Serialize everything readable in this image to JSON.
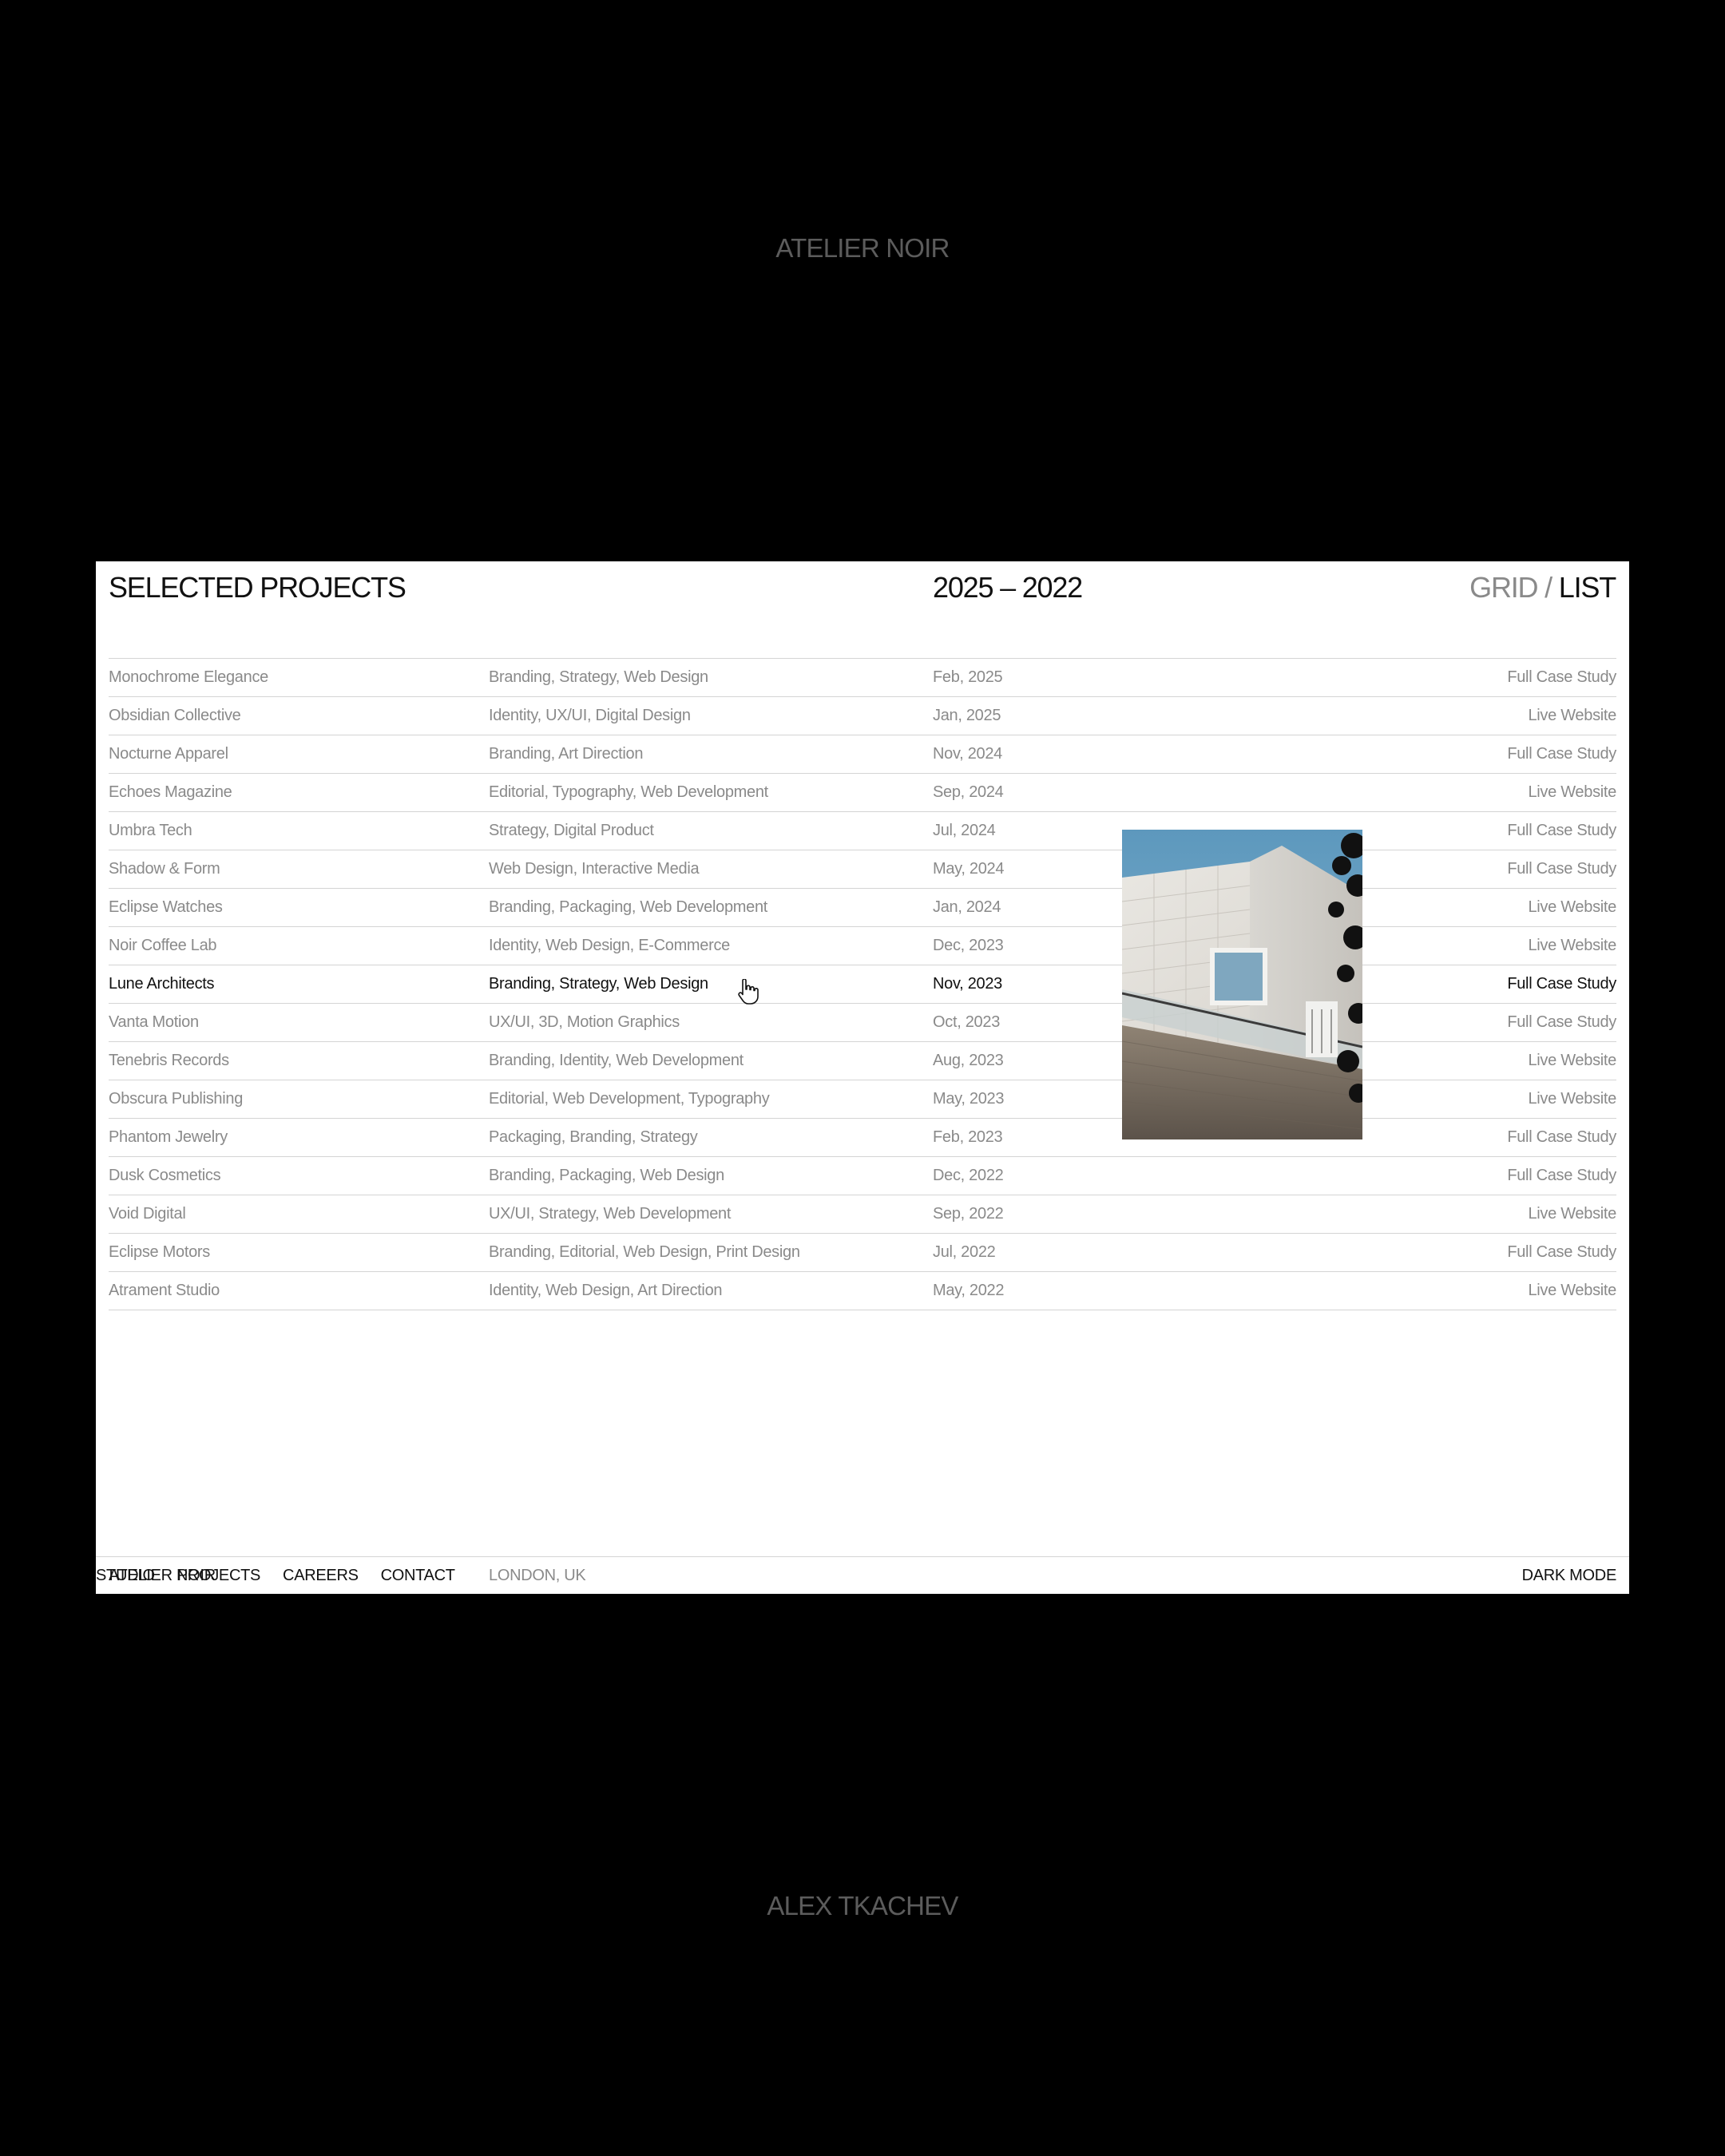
{
  "page": {
    "top_brand": "ATELIER NOIR",
    "bottom_credit": "ALEX TKACHEV"
  },
  "header": {
    "title": "SELECTED PROJECTS",
    "range": "2025 – 2022",
    "view_toggle": {
      "grid": "GRID",
      "separator": " / ",
      "list": "LIST",
      "active": "LIST"
    }
  },
  "projects": [
    {
      "name": "Monochrome Elegance",
      "services": "Branding, Strategy, Web Design",
      "date": "Feb, 2025",
      "link": "Full Case Study"
    },
    {
      "name": "Obsidian Collective",
      "services": "Identity, UX/UI, Digital Design",
      "date": "Jan, 2025",
      "link": "Live Website"
    },
    {
      "name": "Nocturne Apparel",
      "services": "Branding, Art Direction",
      "date": "Nov, 2024",
      "link": "Full Case Study"
    },
    {
      "name": "Echoes Magazine",
      "services": "Editorial, Typography, Web Development",
      "date": "Sep, 2024",
      "link": "Live Website"
    },
    {
      "name": "Umbra Tech",
      "services": "Strategy, Digital Product",
      "date": "Jul, 2024",
      "link": "Full Case Study"
    },
    {
      "name": "Shadow & Form",
      "services": "Web Design, Interactive Media",
      "date": "May, 2024",
      "link": "Full Case Study"
    },
    {
      "name": "Eclipse Watches",
      "services": "Branding, Packaging, Web Development",
      "date": "Jan, 2024",
      "link": "Live Website"
    },
    {
      "name": "Noir Coffee Lab",
      "services": "Identity, Web Design, E-Commerce",
      "date": "Dec, 2023",
      "link": "Live Website"
    },
    {
      "name": "Lune Architects",
      "services": "Branding, Strategy, Web Design",
      "date": "Nov, 2023",
      "link": "Full Case Study",
      "active": true
    },
    {
      "name": "Vanta Motion",
      "services": "UX/UI, 3D, Motion Graphics",
      "date": "Oct, 2023",
      "link": "Full Case Study"
    },
    {
      "name": "Tenebris Records",
      "services": "Branding, Identity, Web Development",
      "date": "Aug, 2023",
      "link": "Live Website"
    },
    {
      "name": "Obscura Publishing",
      "services": "Editorial, Web Development, Typography",
      "date": "May, 2023",
      "link": "Live Website"
    },
    {
      "name": "Phantom Jewelry",
      "services": "Packaging, Branding, Strategy",
      "date": "Feb, 2023",
      "link": "Full Case Study"
    },
    {
      "name": "Dusk Cosmetics",
      "services": "Branding, Packaging, Web Design",
      "date": "Dec, 2022",
      "link": "Full Case Study"
    },
    {
      "name": "Void Digital",
      "services": "UX/UI, Strategy, Web Development",
      "date": "Sep, 2022",
      "link": "Live Website"
    },
    {
      "name": "Eclipse Motors",
      "services": "Branding, Editorial, Web Design, Print Design",
      "date": "Jul, 2022",
      "link": "Full Case Study"
    },
    {
      "name": "Atrament Studio",
      "services": "Identity, Web Design, Art Direction",
      "date": "May, 2022",
      "link": "Live Website"
    }
  ],
  "footer": {
    "brand": "ATELIER NOIR",
    "location": "LONDON, UK",
    "nav": [
      "STUDIO",
      "PROJECTS",
      "CAREERS",
      "CONTACT"
    ],
    "mode": "DARK MODE"
  },
  "colors": {
    "page_background": "#000000",
    "panel_background": "#ffffff",
    "text_primary": "#111111",
    "text_muted": "#8a8a8a",
    "outer_text": "#5c5c5c",
    "divider": "#d4d4d4"
  },
  "icons": {
    "cursor": "hand-pointer-icon"
  }
}
